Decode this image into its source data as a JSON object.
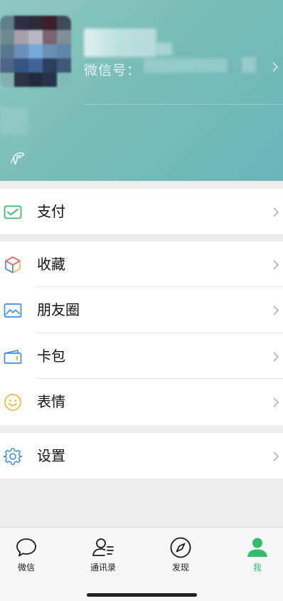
{
  "header": {
    "wxid_label": "微信号：",
    "colors": {
      "gradient_start": "#8fc9c0",
      "gradient_end": "#6ab6ba"
    },
    "icons": {
      "status": "status-icon",
      "chevron": "chevron-right-icon",
      "avatar": "avatar-image"
    }
  },
  "menu": {
    "pay": {
      "label": "支付",
      "icon": "wallet-icon"
    },
    "favorites": {
      "label": "收藏",
      "icon": "cube-icon"
    },
    "moments": {
      "label": "朋友圈",
      "icon": "picture-icon"
    },
    "cards": {
      "label": "卡包",
      "icon": "card-icon"
    },
    "stickers": {
      "label": "表情",
      "icon": "smiley-icon"
    },
    "settings": {
      "label": "设置",
      "icon": "gear-icon"
    }
  },
  "tabs": [
    {
      "label": "微信",
      "icon": "chat-bubble-icon",
      "active": false
    },
    {
      "label": "通讯录",
      "icon": "contacts-icon",
      "active": false
    },
    {
      "label": "发现",
      "icon": "compass-icon",
      "active": false
    },
    {
      "label": "我",
      "icon": "person-icon",
      "active": true
    }
  ],
  "colors": {
    "accent": "#2fbf6a",
    "background": "#ededed",
    "divider": "#e5e5e5"
  }
}
